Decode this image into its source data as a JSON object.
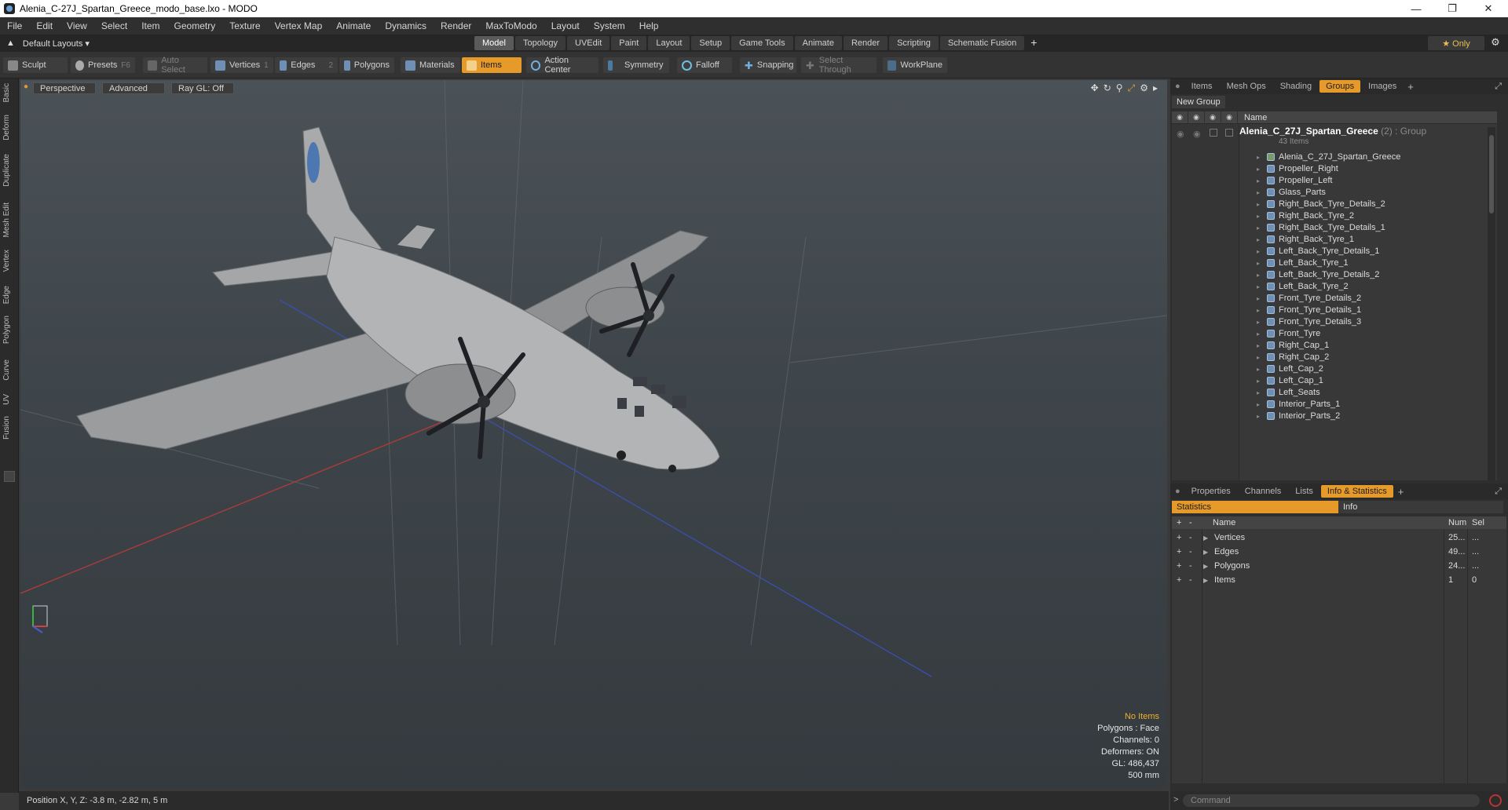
{
  "window": {
    "title": "Alenia_C-27J_Spartan_Greece_modo_base.lxo - MODO"
  },
  "menu": [
    "File",
    "Edit",
    "View",
    "Select",
    "Item",
    "Geometry",
    "Texture",
    "Vertex Map",
    "Animate",
    "Dynamics",
    "Render",
    "MaxToModo",
    "Layout",
    "System",
    "Help"
  ],
  "layout_selector": "Default Layouts ▾",
  "mode_tabs": [
    "Model",
    "Topology",
    "UVEdit",
    "Paint",
    "Layout",
    "Setup",
    "Game Tools",
    "Animate",
    "Render",
    "Scripting",
    "Schematic Fusion"
  ],
  "active_mode_tab": "Model",
  "only_label": "★ Only",
  "toolbar": {
    "sculpt": "Sculpt",
    "presets": "Presets",
    "presets_key": "F6",
    "auto_select": "Auto Select",
    "vertices": "Vertices",
    "vertices_key": "1",
    "edges": "Edges",
    "edges_key": "2",
    "polygons": "Polygons",
    "materials": "Materials",
    "items": "Items",
    "action_center": "Action Center",
    "symmetry": "Symmetry",
    "falloff": "Falloff",
    "snapping": "Snapping",
    "select_through": "Select Through",
    "workplane": "WorkPlane"
  },
  "left_tabs": [
    "Basic",
    "Deform",
    "Duplicate",
    "Mesh Edit",
    "Vertex",
    "Edge",
    "Polygon",
    "Curve",
    "UV",
    "Fusion"
  ],
  "viewport": {
    "view": "Perspective",
    "style": "Advanced",
    "raygl": "Ray GL: Off",
    "hud": {
      "selection": "No Items",
      "polygons": "Polygons : Face",
      "channels": "Channels: 0",
      "deformers": "Deformers: ON",
      "gl": "GL: 486,437",
      "scale": "500 mm"
    }
  },
  "status": {
    "position": "Position X, Y, Z:  -3.8 m, -2.82 m, 5 m"
  },
  "top_panel": {
    "tabs": [
      "Items",
      "Mesh Ops",
      "Shading",
      "Groups",
      "Images"
    ],
    "active": "Groups",
    "new_group": "New Group",
    "name_header": "Name",
    "group_name": "Alenia_C_27J_Spartan_Greece",
    "group_meta": "(2) : Group",
    "group_count": "43 Items",
    "items": [
      "Alenia_C_27J_Spartan_Greece",
      "Propeller_Right",
      "Propeller_Left",
      "Glass_Parts",
      "Right_Back_Tyre_Details_2",
      "Right_Back_Tyre_2",
      "Right_Back_Tyre_Details_1",
      "Right_Back_Tyre_1",
      "Left_Back_Tyre_Details_1",
      "Left_Back_Tyre_1",
      "Left_Back_Tyre_Details_2",
      "Left_Back_Tyre_2",
      "Front_Tyre_Details_2",
      "Front_Tyre_Details_1",
      "Front_Tyre_Details_3",
      "Front_Tyre",
      "Right_Cap_1",
      "Right_Cap_2",
      "Left_Cap_2",
      "Left_Cap_1",
      "Left_Seats",
      "Interior_Parts_1",
      "Interior_Parts_2"
    ]
  },
  "bottom_panel": {
    "tabs": [
      "Properties",
      "Channels",
      "Lists",
      "Info & Statistics"
    ],
    "active": "Info & Statistics",
    "sub_tabs": [
      "Statistics",
      "Info"
    ],
    "headers": {
      "name": "Name",
      "num": "Num",
      "sel": "Sel"
    },
    "rows": [
      {
        "name": "Vertices",
        "num": "25...",
        "sel": "..."
      },
      {
        "name": "Edges",
        "num": "49...",
        "sel": "..."
      },
      {
        "name": "Polygons",
        "num": "24...",
        "sel": "..."
      },
      {
        "name": "Items",
        "num": "1",
        "sel": "0"
      }
    ]
  },
  "command": {
    "placeholder": "Command"
  },
  "colors": {
    "accent": "#e59a2a",
    "panel": "#2e2e2e"
  }
}
